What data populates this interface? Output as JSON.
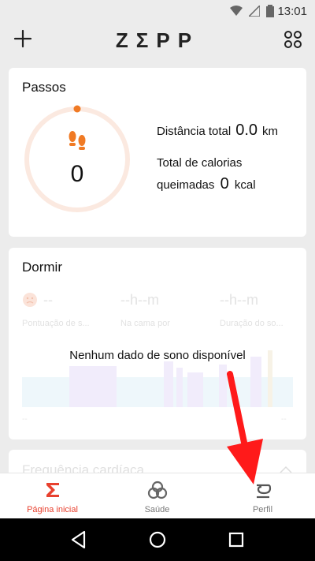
{
  "status_bar": {
    "time": "13:01"
  },
  "top_bar": {
    "brand": "ZΣPP"
  },
  "steps": {
    "title": "Passos",
    "count": "0",
    "distance_label": "Distância total",
    "distance_value": "0.0",
    "distance_unit": "km",
    "calories_label_1": "Total de calorias",
    "calories_label_2": "queimadas",
    "calories_value": "0",
    "calories_unit": "kcal",
    "progress_fraction": 0
  },
  "sleep": {
    "title": "Dormir",
    "metrics": [
      {
        "value": "--",
        "label": "Pontuação de s..."
      },
      {
        "value": "--h--m",
        "label": "Na cama por"
      },
      {
        "value": "--h--m",
        "label": "Duração do so..."
      }
    ],
    "no_data": "Nenhum dado de sono disponível",
    "x_labels": [
      "--",
      "--"
    ]
  },
  "heart_rate": {
    "title": "Frequência cardíaca"
  },
  "tabs": [
    {
      "label": "Página inicial",
      "active": true
    },
    {
      "label": "Saúde",
      "active": false
    },
    {
      "label": "Perfil",
      "active": false
    }
  ],
  "colors": {
    "accent": "#e8412f",
    "steps_orange": "#f07a24",
    "ring": "#fbe9e0"
  }
}
